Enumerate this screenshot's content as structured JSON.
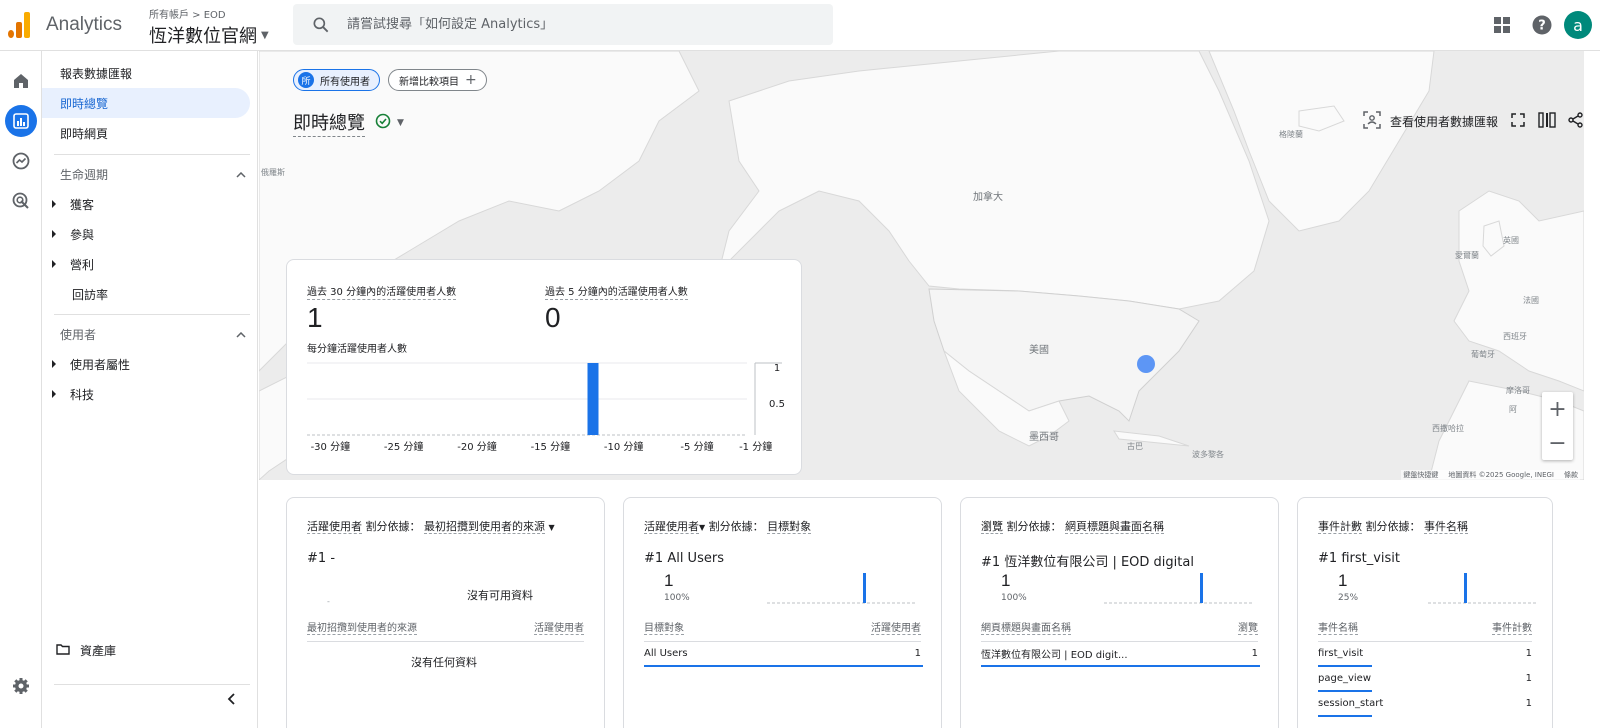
{
  "app": {
    "name": "Analytics",
    "breadcrumb": "所有帳戶 > EOD",
    "property": "恆洋數位官網"
  },
  "search": {
    "placeholder": "請嘗試搜尋「如何設定 Analytics」"
  },
  "header": {
    "avatar_letter": "a"
  },
  "sidebar": {
    "reports_overview": "報表數據匯報",
    "realtime_overview": "即時總覽",
    "realtime_pages": "即時網頁",
    "lifecycle": "生命週期",
    "lifecycle_items": [
      "獲客",
      "參與",
      "營利"
    ],
    "retention": "回訪率",
    "user": "使用者",
    "user_items": [
      "使用者屬性",
      "科技"
    ],
    "library": "資產庫"
  },
  "main": {
    "chip_all_users": "所有使用者",
    "chip_all_users_icon": "所",
    "chip_add_compare": "新增比較項目",
    "page_title": "即時總覽",
    "view_snapshot": "查看使用者數據匯報"
  },
  "map": {
    "labels": {
      "canada": "加拿大",
      "usa": "美國",
      "mexico": "墨西哥",
      "cuba": "古巴",
      "bahamas": "波多黎各",
      "greenland": "格陵蘭",
      "iceland": "愛爾蘭",
      "uk": "英國",
      "france": "法國",
      "spain": "西班牙",
      "portugal": "葡萄牙",
      "morocco": "摩洛哥",
      "algeria": "阿",
      "sahara": "西撒哈拉",
      "russia": "俄羅斯"
    },
    "attribution": [
      "鍵盤快捷鍵",
      "地圖資料 ©2025 Google, INEGI",
      "條款"
    ]
  },
  "realtime": {
    "label_30min": "過去 30 分鐘內的活躍使用者人數",
    "value_30min": "1",
    "label_5min": "過去 5 分鐘內的活躍使用者人數",
    "value_5min": "0",
    "per_minute_label": "每分鐘活躍使用者人數"
  },
  "chart_data": {
    "type": "bar",
    "title": "每分鐘活躍使用者人數",
    "categories": [
      "-30 分鐘",
      "-25 分鐘",
      "-20 分鐘",
      "-15 分鐘",
      "-10 分鐘",
      "-5 分鐘",
      "-1 分鐘"
    ],
    "x_ticks": [
      -30,
      -25,
      -20,
      -15,
      -10,
      -5,
      -1
    ],
    "x": [
      -30,
      -29,
      -28,
      -27,
      -26,
      -25,
      -24,
      -23,
      -22,
      -21,
      -20,
      -19,
      -18,
      -17,
      -16,
      -15,
      -14,
      -13,
      -12,
      -11,
      -10,
      -9,
      -8,
      -7,
      -6,
      -5,
      -4,
      -3,
      -2,
      -1
    ],
    "values": [
      0,
      0,
      0,
      0,
      0,
      0,
      0,
      0,
      0,
      0,
      0,
      0,
      0,
      0,
      0,
      0,
      0,
      0,
      0,
      1,
      0,
      0,
      0,
      0,
      0,
      0,
      0,
      0,
      0,
      0
    ],
    "ylim": [
      0,
      1
    ],
    "y_ticks": [
      "1",
      "0.5"
    ],
    "color": "#1a73e8"
  },
  "cards": [
    {
      "metric": "活躍使用者",
      "split_by": "割分依據：",
      "dimension": "最初招攬到使用者的來源",
      "rank": "#1",
      "top_value": "-",
      "no_data": "沒有可用資料",
      "dash": "-",
      "col_left": "最初招攬到使用者的來源",
      "col_right": "活躍使用者",
      "no_rows": "沒有任何資料"
    },
    {
      "metric": "活躍使用者",
      "split_by": "割分依據：",
      "dimension": "目標對象",
      "rank": "#1",
      "top_value": "All Users",
      "value": "1",
      "pct": "100%",
      "col_left": "目標對象",
      "col_right": "活躍使用者",
      "rows": [
        {
          "name": "All Users",
          "count": "1"
        }
      ]
    },
    {
      "metric": "瀏覽",
      "split_by": "割分依據：",
      "dimension": "網頁標題與畫面名稱",
      "rank": "#1",
      "top_value": "恆洋數位有限公司 | EOD digital",
      "value": "1",
      "pct": "100%",
      "col_left": "網頁標題與畫面名稱",
      "col_right": "瀏覽",
      "rows": [
        {
          "name": "恆洋數位有限公司 | EOD digit...",
          "count": "1"
        }
      ]
    },
    {
      "metric": "事件計數",
      "split_by": "割分依據：",
      "dimension": "事件名稱",
      "rank": "#1",
      "top_value": "first_visit",
      "value": "1",
      "pct": "25%",
      "col_left": "事件名稱",
      "col_right": "事件計數",
      "rows": [
        {
          "name": "first_visit",
          "count": "1"
        },
        {
          "name": "page_view",
          "count": "1"
        },
        {
          "name": "session_start",
          "count": "1"
        }
      ]
    }
  ]
}
